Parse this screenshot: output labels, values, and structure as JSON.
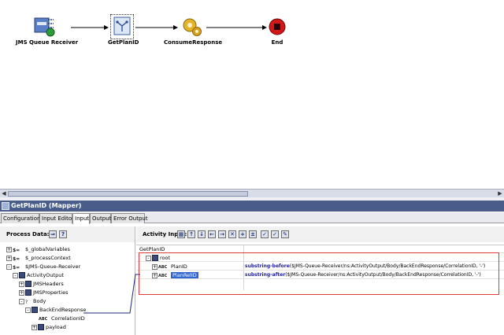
{
  "process": {
    "nodes": [
      {
        "id": "jms",
        "label": "JMS Queue Receiver",
        "icon": "jms-receiver-icon"
      },
      {
        "id": "getplan",
        "label": "GetPlanID",
        "icon": "mapper-icon"
      },
      {
        "id": "consume",
        "label": "ConsumeResponse",
        "icon": "gears-icon"
      },
      {
        "id": "end",
        "label": "End",
        "icon": "stop-icon"
      }
    ]
  },
  "window": {
    "title": "GetPlanID (Mapper)"
  },
  "tabs": [
    {
      "label": "Configuration",
      "active": false
    },
    {
      "label": "Input Editor",
      "active": false
    },
    {
      "label": "Input",
      "active": true
    },
    {
      "label": "Output",
      "active": false
    },
    {
      "label": "Error Output",
      "active": false
    }
  ],
  "left_panel": {
    "title": "Process Data:",
    "tree": [
      {
        "label": "$_globalVariables",
        "level": 0,
        "exp": "+",
        "icon": "$="
      },
      {
        "label": "$_processContext",
        "level": 0,
        "exp": "+",
        "icon": "$="
      },
      {
        "label": "$JMS-Queue-Receiver",
        "level": 0,
        "exp": "-",
        "icon": "$="
      },
      {
        "label": "ActivityOutput",
        "level": 1,
        "exp": "-",
        "icon": "grid"
      },
      {
        "label": "JMSHeaders",
        "level": 2,
        "exp": "+",
        "icon": "grid"
      },
      {
        "label": "JMSProperties",
        "level": 2,
        "exp": "+",
        "icon": "grid"
      },
      {
        "label": "Body",
        "level": 2,
        "exp": "-",
        "icon": "?"
      },
      {
        "label": "BackEndResponse",
        "level": 3,
        "exp": "-",
        "icon": "grid"
      },
      {
        "label": "CorrelationID",
        "level": 4,
        "exp": "",
        "icon": "ABC"
      },
      {
        "label": "payload",
        "level": 4,
        "exp": "+",
        "icon": "grid"
      }
    ]
  },
  "right_panel": {
    "title": "Activity Input:",
    "rows": [
      {
        "name": "GetPlanID",
        "expr_fn": "",
        "expr_rest": "",
        "level": 0,
        "icon": "",
        "selected": false
      },
      {
        "name": "root",
        "expr_fn": "",
        "expr_rest": "",
        "level": 1,
        "icon": "grid",
        "selected": false
      },
      {
        "name": "PlanID",
        "expr_fn": "substring-before",
        "expr_rest": "($JMS-Queue-Receiver/ns:ActivityOutput/Body/BackEndResponse/CorrelationID, '-')",
        "level": 2,
        "icon": "ABC",
        "selected": false
      },
      {
        "name": "PlanRelID",
        "expr_fn": "substring-after",
        "expr_rest": "($JMS-Queue-Receiver/ns:ActivityOutput/Body/BackEndResponse/CorrelationID, '-')",
        "level": 2,
        "icon": "ABC",
        "selected": true
      }
    ]
  },
  "colors": {
    "titlebar": "#4a5d8a",
    "highlight": "#3366cc",
    "red_box": "#e23a3a",
    "function": "#1a1aa8"
  }
}
